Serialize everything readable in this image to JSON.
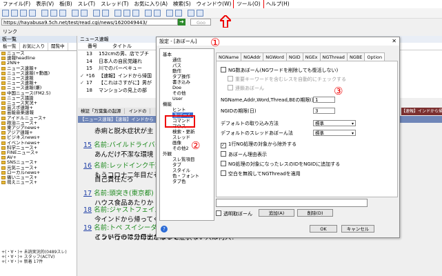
{
  "menu": [
    "ファイル(F)",
    "表示(V)",
    "板(B)",
    "スレ(T)",
    "スレッド(T)",
    "お気に入り(A)",
    "検索(S)",
    "ウィンドウ(W)",
    "ツール(O)",
    "ヘルプ(H)"
  ],
  "address": {
    "url": "https://hayabusa9.5ch.net/test/read.cgi/news/1620049443/",
    "search_placeholder": "Goo"
  },
  "linkbar": {
    "label": "リンク"
  },
  "left_panel": {
    "title": "板一覧",
    "tabs": [
      "板一覧",
      "お気に入り",
      "閲覧中"
    ],
    "items": [
      "ニュース",
      "速報headline",
      "2NN+",
      "ニュース速報+",
      "ニュース速報(+動画)",
      "ニュース速報",
      "ニュース速報+",
      "ニュース速報(嫌)",
      "中国ニュース(FM2.5)",
      "ニュース議論",
      "ニュース実況+",
      "芸スポ速報+",
      "芸能音楽速報",
      "アイドルニュース+",
      "政治ニュース+",
      "東アジアnews+",
      "アジア速報+",
      "ビジネスnews+",
      "イベントnews+",
      "科学ニュース+",
      "FINEニュース+",
      "AV+",
      "SNSニュース+",
      "元気ニュース+",
      "ローカルnews+",
      "痛いニュース+",
      "萌えニュース+"
    ],
    "bottom_lines": [
      "+(・∀・)+ 未読実況的(0489スレ)",
      "+(・∀・)+ スタッフ(ACTV)",
      "+(・∀・)+ 新着 17件"
    ]
  },
  "thread_list": {
    "title": "ニュース速報",
    "header": [
      "番号",
      "タイトル"
    ],
    "rows": [
      {
        "mark": "",
        "num": "13",
        "title": "152cmの男、店でブチ"
      },
      {
        "mark": "",
        "num": "14",
        "title": "日本人の自民党離れ"
      },
      {
        "mark": "",
        "num": "15",
        "title": "川でのバーベキュー"
      },
      {
        "mark": "✓",
        "num": "*16",
        "title": "【速報】インドから帰国"
      },
      {
        "mark": "✓",
        "num": "17",
        "title": "【これはさすがに】男が"
      },
      {
        "mark": "",
        "num": "18",
        "title": "マンションの見上の部"
      }
    ]
  },
  "thread_tabs": [
    "検証「万葉集の起源",
    "インドの"
  ],
  "right_tab": "【速報】インドから帰",
  "thread_view_title": "【ニュース速報】【速報】インドから",
  "posts": [
    {
      "num": "",
      "name": "",
      "body": "赤痢と脱水症状が主"
    },
    {
      "num": "15",
      "name": "名前:バイルドライバー",
      "body": "あんだけ不潔な環境"
    },
    {
      "num": "16",
      "name": "名前:レッドインク千葉",
      "body": "もうコロナ二年目だぞ"
    },
    {
      "num": "",
      "name": "",
      "body": "自己責任だろ"
    },
    {
      "num": "17",
      "name": "名前:頭突き(東京都)",
      "body": "ハウス食品あたりか"
    },
    {
      "num": "18",
      "name": "名前:ジャストフェイス",
      "body": "今インドから帰ってくるようなのは隔離されて当たり前でしょ"
    },
    {
      "num": "19",
      "name": "名前:トペ スイシーダ(秋) [CN][sage] 投稿日：2021/05/03(月) 22:49:44.30 ID:kLMbZZ+u0",
      "body": "インド行ってコロナかかって症状ない人は何人？"
    },
    {
      "num": "",
      "name": "",
      "body": "こういうのは分母出さないと"
    }
  ],
  "dialog": {
    "title": "設定 - [あぼーん]",
    "tree": {
      "basic": "基本",
      "basic_children": [
        "通信",
        "パス",
        "動作",
        "タブ操作",
        "書き込み",
        "Doe",
        "その他",
        "User"
      ],
      "function": "機能",
      "function_children": [
        "ヒント",
        "あぼーん",
        "コマンド",
        "マウス",
        "検索・更新",
        "スレッド",
        "画像",
        "その他2"
      ],
      "appearance": "外観",
      "appearance_children": [
        "スレ覧項目",
        "タブ",
        "スタイル",
        "色・フォント",
        "タブ色"
      ]
    },
    "tabs": [
      "NGName",
      "NGAddr",
      "NGWord",
      "NGID",
      "NGEx",
      "NGThread",
      "NGBE",
      "Option"
    ],
    "options": {
      "ng_count_abone": "NG数あぼーん(NGワードを削除しても復活しない)",
      "check_duplicate": "重要キーワードを含むレスを自動的にチェックする",
      "chain_abone": "連鎖あぼーん",
      "ng_period_label": "NGName,Addr,Word,Thread,BEの期限(日)",
      "ng_period_value": "1",
      "ngid_period_label": "NGIDの期限(日)",
      "ngid_period_value": "3",
      "default_abone_label": "デフォルトの取り込み方法",
      "default_abone_value": "標準",
      "default_thread_abone_label": "デフォルトのスレッドあぼーん法",
      "default_thread_abone_value": "標準",
      "ng_one_target": "1行NG処理の対象から除外する",
      "show_abone_reason": "あぼーん理由表示",
      "add_ngid": "NG処理の対象になったレスのIDをNGIDに追加する",
      "ignore_space": "空白を無視してNGThreadを適用"
    },
    "transparent_abone": "透明取ぼーん",
    "add_button": "追加(A)",
    "delete_button": "削除(D)",
    "ok_button": "OK",
    "cancel_button": "キャンセル"
  },
  "annotations": {
    "circle1": "①",
    "circle2": "②",
    "circle3": "③"
  },
  "colors": {
    "annotation_red": "#ee0000",
    "thread_title_bar": "#6f86b8"
  }
}
